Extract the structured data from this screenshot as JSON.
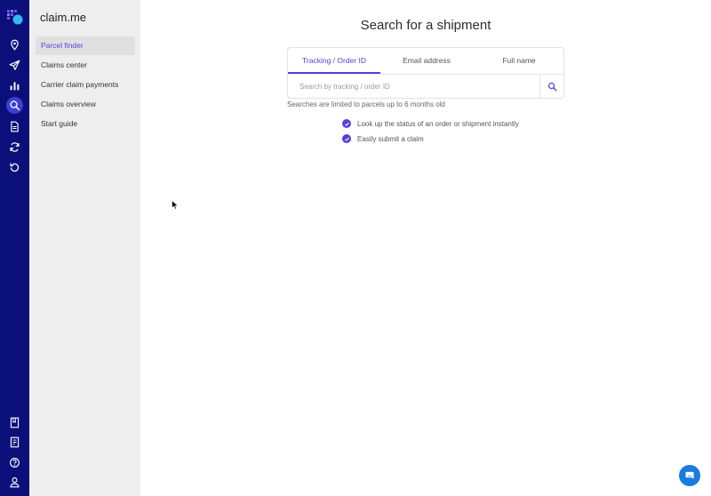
{
  "brand": "claim.me",
  "rail": {
    "icons": [
      "location-icon",
      "send-icon",
      "bar-chart-icon",
      "search-icon",
      "document-icon",
      "refresh-icon",
      "history-icon"
    ],
    "bottom_icons": [
      "book-icon",
      "notes-icon",
      "help-icon",
      "user-icon"
    ],
    "active": "search-icon"
  },
  "sidebar": {
    "items": [
      {
        "label": "Parcel finder",
        "active": true
      },
      {
        "label": "Claims center"
      },
      {
        "label": "Carrier claim payments"
      },
      {
        "label": "Claims overview"
      },
      {
        "label": "Start guide"
      }
    ]
  },
  "main": {
    "title": "Search for a shipment",
    "tabs": [
      {
        "label": "Tracking / Order ID",
        "active": true
      },
      {
        "label": "Email address"
      },
      {
        "label": "Full name"
      }
    ],
    "search_placeholder": "Search by tracking / order ID",
    "note": "Searches are limited to parcels up to 6 months old",
    "features": [
      "Look up the status of an order or shipment instantly",
      "Easily submit a claim"
    ]
  },
  "colors": {
    "rail_bg": "#0b0f7a",
    "accent": "#5b3fd9",
    "chat": "#1a7be0"
  }
}
